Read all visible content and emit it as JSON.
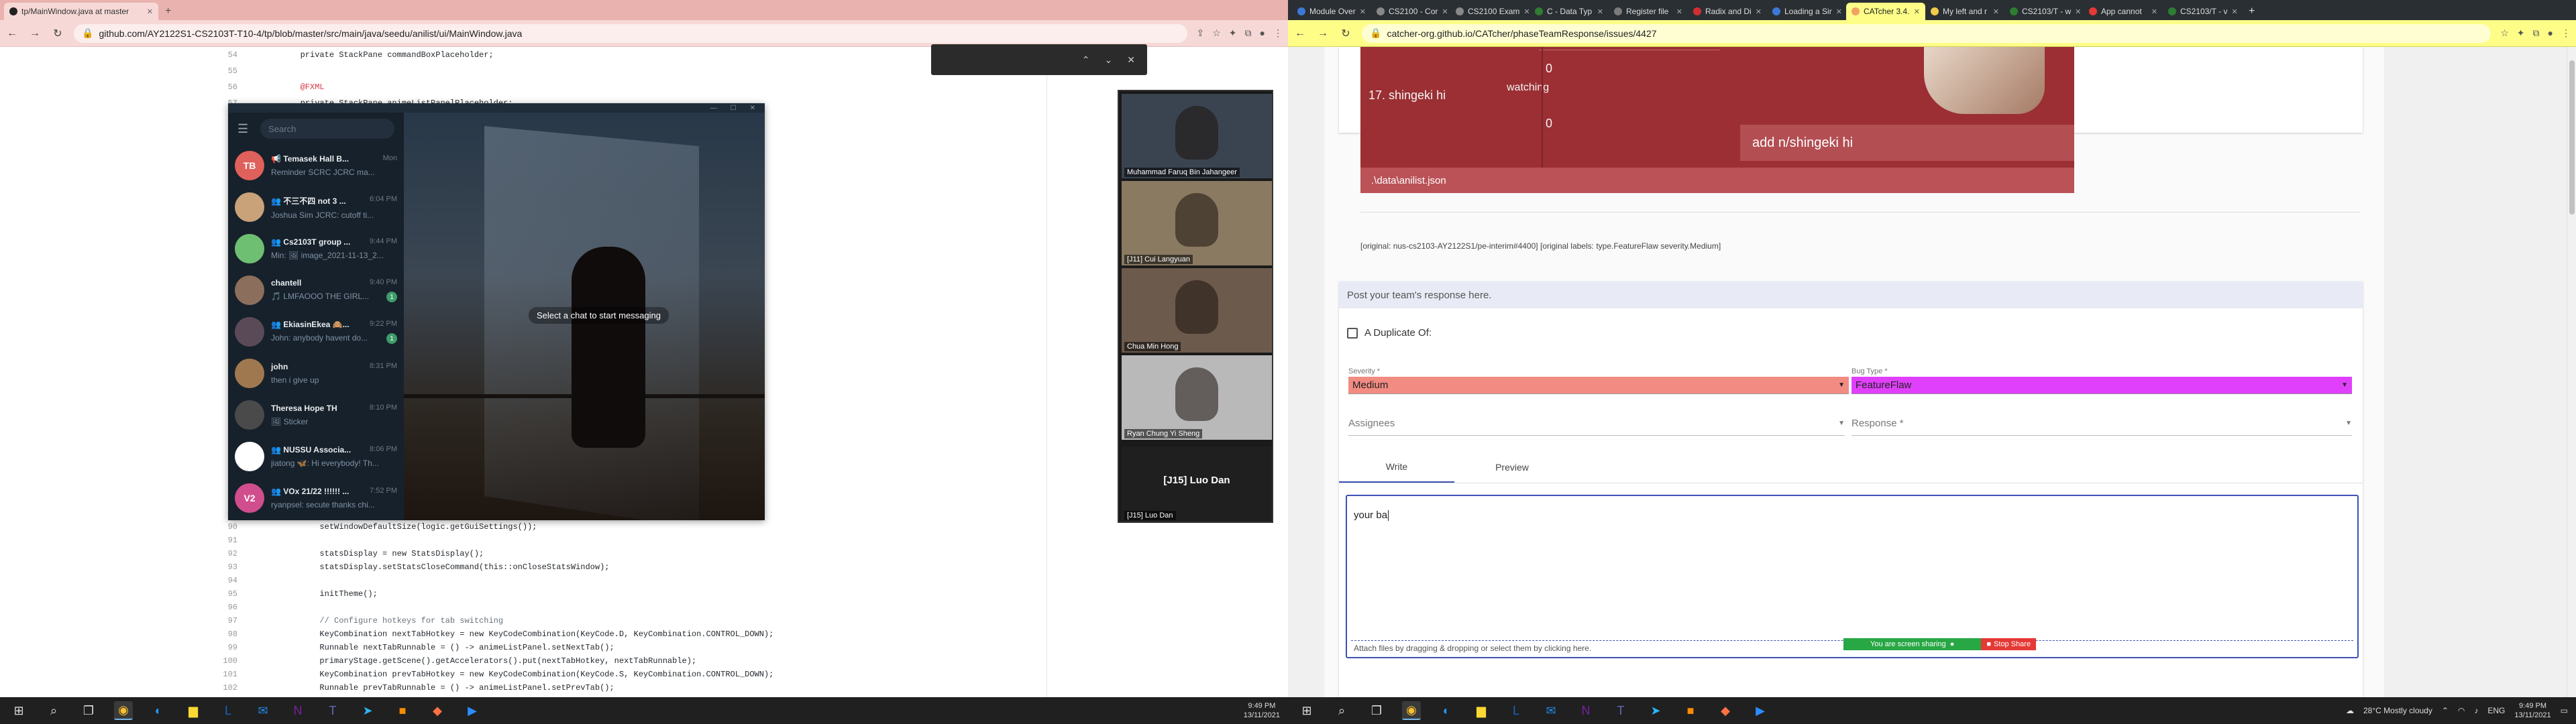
{
  "left_browser": {
    "tab_title": "tp/MainWindow.java at master",
    "url": "github.com/AY2122S1-CS2103T-T10-4/tp/blob/master/src/main/java/seedu/anilist/ui/MainWindow.java",
    "code_top": [
      {
        "ln": "54",
        "text": "        private StackPane commandBoxPlaceholder;"
      },
      {
        "ln": "55",
        "text": ""
      },
      {
        "ln": "56",
        "text": "        @FXML"
      },
      {
        "ln": "57",
        "text": "        private StackPane animeListPanelPlaceholder;"
      }
    ],
    "code_bottom": [
      {
        "ln": "90",
        "text": "            setWindowDefaultSize(logic.getGuiSettings());"
      },
      {
        "ln": "91",
        "text": ""
      },
      {
        "ln": "92",
        "text": "            statsDisplay = new StatsDisplay();"
      },
      {
        "ln": "93",
        "text": "            statsDisplay.setStatsCloseCommand(this::onCloseStatsWindow);"
      },
      {
        "ln": "94",
        "text": ""
      },
      {
        "ln": "95",
        "text": "            initTheme();"
      },
      {
        "ln": "96",
        "text": ""
      },
      {
        "ln": "97",
        "text": "            // Configure hotkeys for tab switching"
      },
      {
        "ln": "98",
        "text": "            KeyCombination nextTabHotkey = new KeyCodeCombination(KeyCode.D, KeyCombination.CONTROL_DOWN);"
      },
      {
        "ln": "99",
        "text": "            Runnable nextTabRunnable = () -> animeListPanel.setNextTab();"
      },
      {
        "ln": "100",
        "text": "            primaryStage.getScene().getAccelerators().put(nextTabHotkey, nextTabRunnable);"
      },
      {
        "ln": "101",
        "text": "            KeyCombination prevTabHotkey = new KeyCodeCombination(KeyCode.S, KeyCombination.CONTROL_DOWN);"
      },
      {
        "ln": "102",
        "text": "            Runnable prevTabRunnable = () -> animeListPanel.setPrevTab();"
      }
    ]
  },
  "telegram": {
    "search_placeholder": "Search",
    "empty_message": "Select a chat to start messaging",
    "chats": [
      {
        "initials": "TB",
        "name": "📢 Temasek Hall B...",
        "time": "Mon",
        "preview": "Reminder SCRC JCRC ma...",
        "badge": "",
        "color": "#e0605b"
      },
      {
        "initials": "",
        "name": "👥 不三不四 not 3 ...",
        "time": "6:04 PM",
        "preview": "Joshua Sim JCRC: cutoff ti...",
        "badge": "",
        "color": "#c9a27a"
      },
      {
        "initials": "",
        "name": "👥 Cs2103T group ...",
        "time": "9:44 PM",
        "preview": "Min: 🖼 image_2021-11-13_2...",
        "badge": "",
        "color": "#6fbf73"
      },
      {
        "initials": "",
        "name": "chantell",
        "time": "9:40 PM",
        "preview": "🎵 LMFAOOO THE GIRL...",
        "badge": "1",
        "color": "#8b6f5c"
      },
      {
        "initials": "",
        "name": "👥 EkiasinEkea 🙈...",
        "time": "9:22 PM",
        "preview": "John: anybody havent do...",
        "badge": "1",
        "color": "#5a4a58"
      },
      {
        "initials": "",
        "name": "john",
        "time": "8:31 PM",
        "preview": "then i give up",
        "badge": "",
        "color": "#a07850"
      },
      {
        "initials": "",
        "name": "Theresa Hope TH",
        "time": "8:10 PM",
        "preview": "🖼 Sticker",
        "badge": "",
        "color": "#4a4a4a"
      },
      {
        "initials": "",
        "name": "👥 NUSSU Associa...",
        "time": "8:06 PM",
        "preview": "jiatong 🦋: Hi everybody! Th...",
        "badge": "",
        "color": "#ffffff"
      },
      {
        "initials": "V2",
        "name": "👥 VOx 21/22 !!!!!! ...",
        "time": "7:52 PM",
        "preview": "ryanpsel: secute thanks chi...",
        "badge": "",
        "color": "#d04e8d"
      }
    ]
  },
  "zoom": {
    "participants": [
      {
        "name": "Muhammad Faruq Bin Jahangeer",
        "bg": "#3a4450"
      },
      {
        "name": "[J11] Cui Langyuan",
        "bg": "#8a7a62"
      },
      {
        "name": "Chua Min Hong",
        "bg": "#6c5a4c"
      },
      {
        "name": "Ryan Chung Yi Sheng",
        "bg": "#b9b9b9"
      }
    ],
    "active_speaker": "[J15] Luo Dan",
    "active_speaker_caption": "[J15] Luo Dan"
  },
  "right_browser": {
    "tabs": [
      {
        "title": "Module Over",
        "color": "#3c78d8"
      },
      {
        "title": "CS2100 - Cor",
        "color": "#888888"
      },
      {
        "title": "CS2100 Exam",
        "color": "#888888"
      },
      {
        "title": "C - Data Typ",
        "color": "#2e7d32"
      },
      {
        "title": "Register file",
        "color": "#7b7b7b"
      },
      {
        "title": "Radix and Di",
        "color": "#d32f2f"
      },
      {
        "title": "Loading a Sir",
        "color": "#3c78d8"
      },
      {
        "title": "CATcher 3.4.",
        "color": "#f4a261"
      },
      {
        "title": "My left and r",
        "color": "#f2c94c"
      },
      {
        "title": "CS2103/T - w",
        "color": "#2e7d32"
      },
      {
        "title": "App cannot",
        "color": "#e53935"
      },
      {
        "title": "CS2103/T - v",
        "color": "#2e7d32"
      }
    ],
    "active_tab_index": 7,
    "url": "catcher-org.github.io/CATcher/phaseTeamResponse/issues/4427"
  },
  "catcher": {
    "list_rows": [
      {
        "text": "0"
      },
      {
        "text": "17.  shingeki hi"
      },
      {
        "text": "watching"
      },
      {
        "text": "0"
      }
    ],
    "add_box": "add n/shingeki hi",
    "path": ".\\data\\anilist.json",
    "original_line": "[original: nus-cs2103-AY2122S1/pe-interim#4400] [original labels: type.FeatureFlaw severity.Medium]",
    "response_hint": "Post your team's response here.",
    "duplicate_label": "A Duplicate Of:",
    "severity_label": "Severity *",
    "severity_value": "Medium",
    "bugtype_label": "Bug Type *",
    "bugtype_value": "FeatureFlaw",
    "assignees_placeholder": "Assignees",
    "response_placeholder": "Response *",
    "tab_write": "Write",
    "tab_preview": "Preview",
    "textarea_value": "your ba",
    "attach_hint": "Attach files by dragging & dropping or select them by clicking here.",
    "sharing_text": "You are screen sharing",
    "stop_share": "Stop Share",
    "colors": {
      "severity": "#f28b82",
      "bugtype": "#e040fb",
      "accent": "#3f51b5"
    }
  },
  "taskbar_left": {
    "time": "9:49 PM",
    "date": "13/11/2021"
  },
  "taskbar_right": {
    "weather": "28°C  Mostly cloudy",
    "lang": "ENG",
    "time": "9:49 PM",
    "date": "13/11/2021"
  }
}
